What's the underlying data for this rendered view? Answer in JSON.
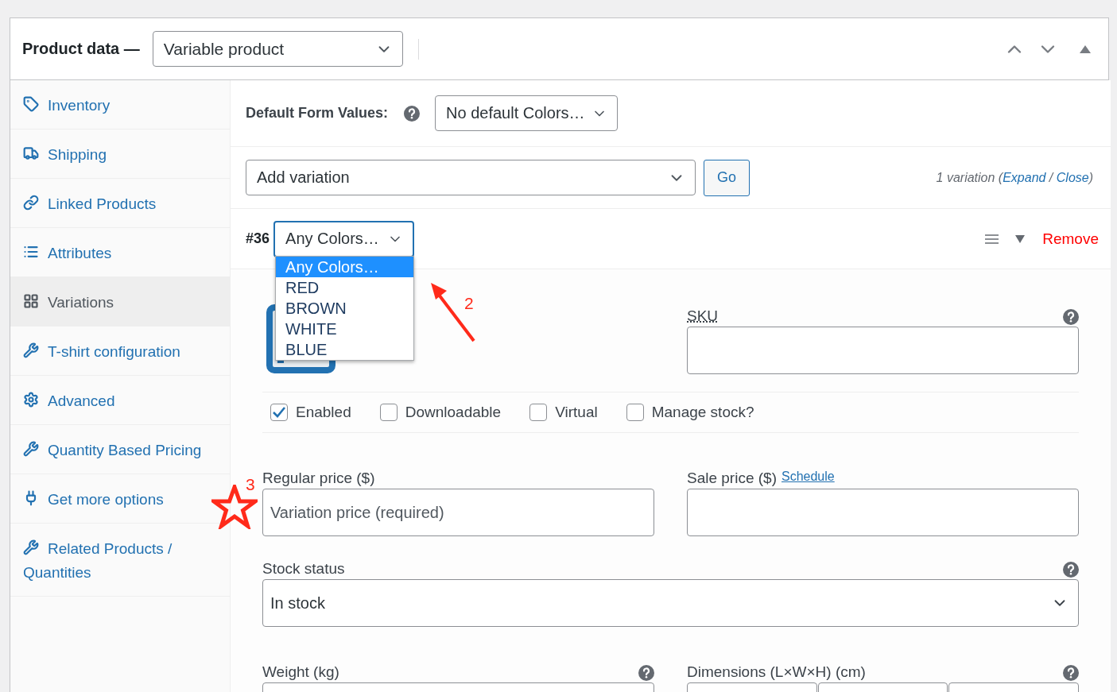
{
  "header": {
    "title": "Product data —",
    "product_type": "Variable product"
  },
  "sidebar": {
    "items": [
      {
        "label": "Inventory",
        "selected": false
      },
      {
        "label": "Shipping",
        "selected": false
      },
      {
        "label": "Linked Products",
        "selected": false
      },
      {
        "label": "Attributes",
        "selected": false
      },
      {
        "label": "Variations",
        "selected": true
      },
      {
        "label": "T-shirt configuration",
        "selected": false
      },
      {
        "label": "Advanced",
        "selected": false
      },
      {
        "label": "Quantity Based Pricing",
        "selected": false
      },
      {
        "label": "Get more options",
        "selected": false
      },
      {
        "label": "Related Products / Quantities",
        "selected": false
      }
    ]
  },
  "default_form_values": {
    "label": "Default Form Values:",
    "value": "No default Colors…"
  },
  "add_variation": {
    "value": "Add variation",
    "button": "Go",
    "summary_prefix": "1 variation (",
    "expand": "Expand",
    "separator": " / ",
    "close": "Close",
    "summary_suffix": ")"
  },
  "variation": {
    "number": "#36",
    "attribute": {
      "value": "Any Colors…",
      "open": true,
      "options": [
        {
          "label": "Any Colors…",
          "selected": true
        },
        {
          "label": "RED",
          "selected": false
        },
        {
          "label": "BROWN",
          "selected": false
        },
        {
          "label": "WHITE",
          "selected": false
        },
        {
          "label": "BLUE",
          "selected": false
        }
      ]
    },
    "remove": "Remove",
    "sku_label": "SKU",
    "checkboxes": [
      {
        "label": "Enabled",
        "checked": true
      },
      {
        "label": "Downloadable",
        "checked": false
      },
      {
        "label": "Virtual",
        "checked": false
      },
      {
        "label": "Manage stock?",
        "checked": false
      }
    ],
    "regular_price": {
      "label": "Regular price ($)",
      "placeholder": "Variation price (required)"
    },
    "sale_price": {
      "label": "Sale price ($)",
      "link": "Schedule"
    },
    "stock_status": {
      "label": "Stock status",
      "value": "In stock"
    },
    "weight": {
      "label": "Weight (kg)"
    },
    "dimensions": {
      "label": "Dimensions (L×W×H) (cm)"
    }
  },
  "annotations": [
    {
      "kind": "arrow",
      "label": "2"
    },
    {
      "kind": "star",
      "label": "3"
    }
  ]
}
